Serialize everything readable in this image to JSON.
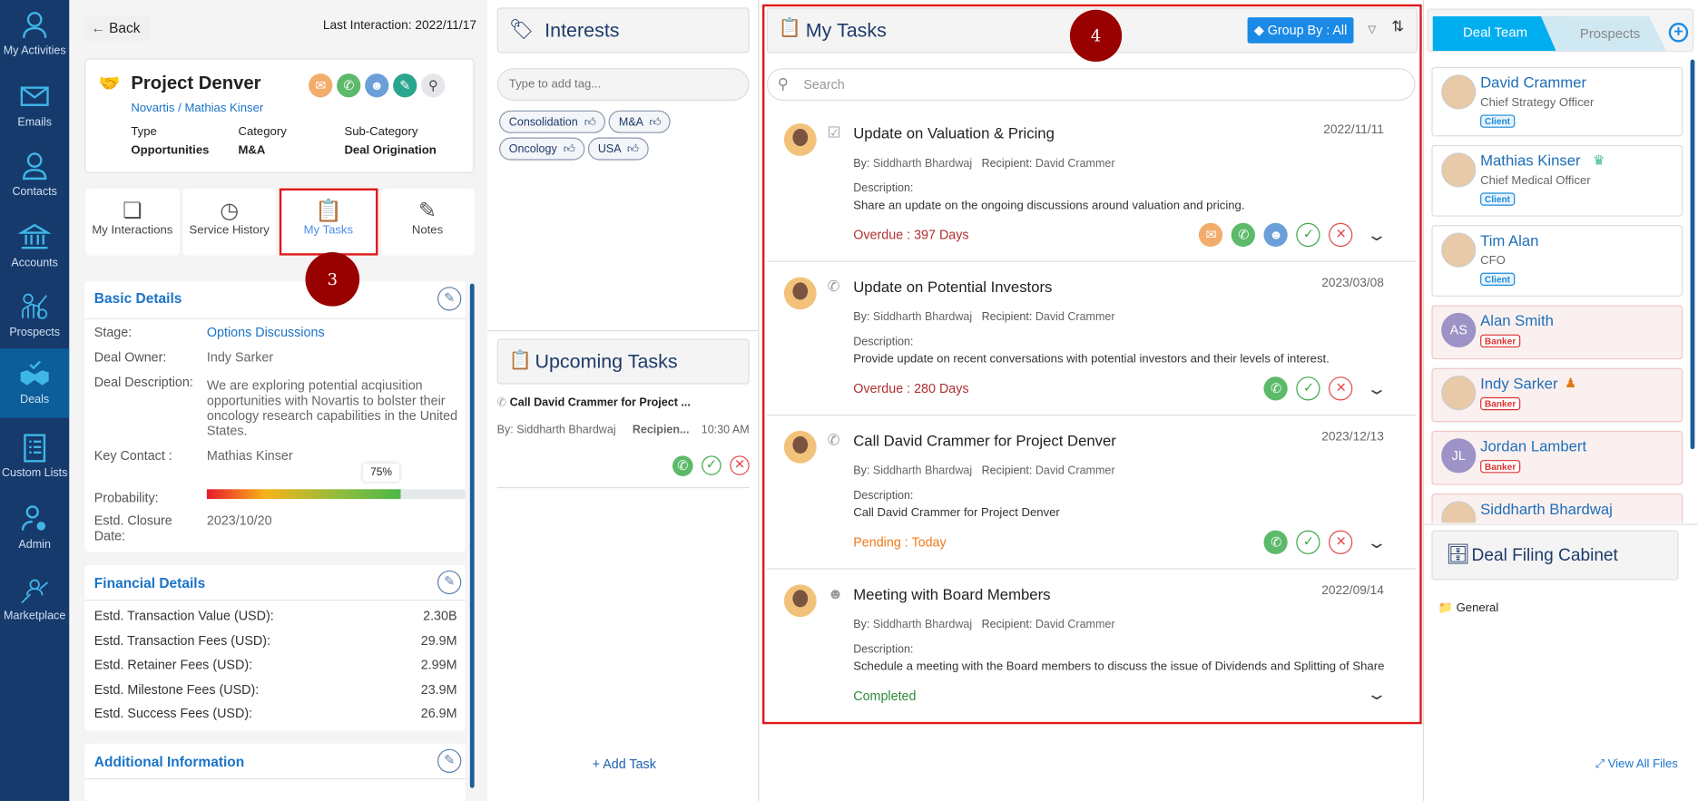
{
  "sidebar": {
    "items": [
      {
        "label": "My Activities",
        "icon": "user-check-icon"
      },
      {
        "label": "Emails",
        "icon": "envelope-icon"
      },
      {
        "label": "Contacts",
        "icon": "user-icon"
      },
      {
        "label": "Accounts",
        "icon": "bank-icon"
      },
      {
        "label": "Prospects",
        "icon": "chart-gear-icon"
      },
      {
        "label": "Deals",
        "icon": "handshake-icon",
        "active": true
      },
      {
        "label": "Custom Lists",
        "icon": "clipboard-list-icon"
      },
      {
        "label": "Admin",
        "icon": "user-gear-icon"
      },
      {
        "label": "Marketplace",
        "icon": "marketplace-icon"
      }
    ]
  },
  "header": {
    "back": "Back",
    "last_interaction": "Last Interaction: 2022/11/17"
  },
  "deal": {
    "title": "Project Denver",
    "subtitle": "Novartis / Mathias Kinser",
    "fields": [
      {
        "label": "Type",
        "value": "Opportunities"
      },
      {
        "label": "Category",
        "value": "M&A"
      },
      {
        "label": "Sub-Category",
        "value": "Deal Origination"
      }
    ]
  },
  "tabs": [
    {
      "label": "My Interactions"
    },
    {
      "label": "Service History"
    },
    {
      "label": "My Tasks",
      "active": true
    },
    {
      "label": "Notes"
    }
  ],
  "annotations": {
    "a3": "3",
    "a4": "4"
  },
  "basic": {
    "title": "Basic Details",
    "stage_l": "Stage:",
    "stage": "Options Discussions",
    "owner_l": "Deal Owner:",
    "owner": "Indy Sarker",
    "desc_l": "Deal Description:",
    "desc": "We are exploring potential acqiusition opportunities with Novartis to bolster their oncology research capabilities in the United States.",
    "key_l": "Key Contact :",
    "key": "Mathias Kinser",
    "prob_l": "Probability:",
    "prob": "75%",
    "prob_value": 75,
    "close_l": "Estd. Closure Date:",
    "close": "2023/10/20"
  },
  "financial": {
    "title": "Financial Details",
    "rows": [
      {
        "label": "Estd. Transaction Value (USD):",
        "value": "2.30B"
      },
      {
        "label": "Estd. Transaction Fees (USD):",
        "value": "29.9M"
      },
      {
        "label": "Estd. Retainer Fees (USD):",
        "value": "2.99M"
      },
      {
        "label": "Estd. Milestone Fees (USD):",
        "value": "23.9M"
      },
      {
        "label": "Estd. Success Fees (USD):",
        "value": "26.9M"
      }
    ]
  },
  "additional": {
    "title": "Additional Information"
  },
  "interests": {
    "title": "Interests",
    "placeholder": "Type to add tag...",
    "tags": [
      "Consolidation",
      "M&A",
      "Oncology",
      "USA"
    ]
  },
  "upcoming": {
    "title": "Upcoming Tasks",
    "task": {
      "title": "Call David Crammer for Project ...",
      "by": "By: Siddharth Bhardwaj",
      "recipient": "Recipien...",
      "time": "10:30 AM"
    },
    "add": "+ Add Task"
  },
  "tasks": {
    "title": "My Tasks",
    "group_by": "Group By : All",
    "search_placeholder": "Search",
    "items": [
      {
        "title": "Update on Valuation & Pricing",
        "date": "2022/11/11",
        "by": "Siddharth Bhardwaj",
        "recipient": "David Crammer",
        "desc": "Share an update on the ongoing discussions around valuation and pricing.",
        "status": "Overdue : 397 Days",
        "status_color": "#b03030",
        "type": "task-icon"
      },
      {
        "title": "Update on Potential Investors",
        "date": "2023/03/08",
        "by": "Siddharth Bhardwaj",
        "recipient": "David Crammer",
        "desc": "Provide update on recent conversations with potential investors and their levels of interest.",
        "status": "Overdue : 280 Days",
        "status_color": "#b03030",
        "type": "phone-icon"
      },
      {
        "title": "Call David Crammer for Project Denver",
        "date": "2023/12/13",
        "by": "Siddharth Bhardwaj",
        "recipient": "David Crammer",
        "desc": "Call David Crammer for Project Denver",
        "status": "Pending : Today",
        "status_color": "#f07a1a",
        "type": "phone-icon"
      },
      {
        "title": "Meeting with Board Members",
        "date": "2022/09/14",
        "by": "Siddharth Bhardwaj",
        "recipient": "David Crammer",
        "desc": "Schedule a meeting with the Board members to discuss the issue of Dividends and Splitting of Share",
        "status": "Completed",
        "status_color": "#2e8b3a",
        "type": "meeting-icon"
      }
    ],
    "by_l": "By:",
    "rec_l": "Recipient:",
    "desc_l": "Description:"
  },
  "team": {
    "tab_active": "Deal Team",
    "tab_other": "Prospects",
    "members": [
      {
        "name": "David Crammer",
        "role": "Chief Strategy Officer",
        "badge": "Client"
      },
      {
        "name": "Mathias Kinser",
        "role": "Chief Medical Officer",
        "badge": "Client"
      },
      {
        "name": "Tim Alan",
        "role": "CFO",
        "badge": "Client"
      },
      {
        "name": "Alan Smith",
        "initials": "AS",
        "badge": "Banker"
      },
      {
        "name": "Indy Sarker",
        "badge": "Banker"
      },
      {
        "name": "Jordan Lambert",
        "initials": "JL",
        "badge": "Banker"
      },
      {
        "name": "Siddharth Bhardwaj"
      }
    ]
  },
  "filing": {
    "title": "Deal Filing Cabinet",
    "folder": "General",
    "view_all": "View All Files"
  },
  "colors": {
    "sidebar": "#163a6b",
    "accent": "#1a73c8",
    "annotation": "#990000",
    "group_by": "#1a8ae6"
  }
}
